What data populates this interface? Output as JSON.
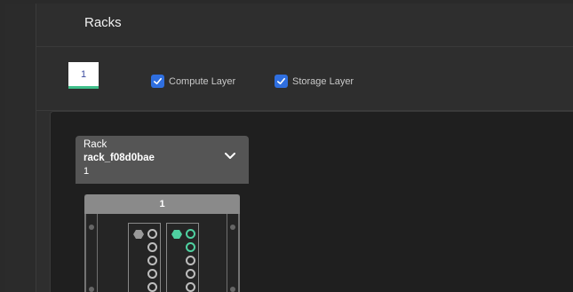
{
  "page": {
    "title": "Racks"
  },
  "controls": {
    "tab_label": "1",
    "compute_layer": {
      "label": "Compute Layer",
      "checked": true
    },
    "storage_layer": {
      "label": "Storage Layer",
      "checked": true
    }
  },
  "rack": {
    "type_label": "Rack",
    "name": "rack_f08d0bae",
    "number": "1",
    "header_label": "1"
  },
  "colors": {
    "accent_green": "#4fd1a1",
    "checkbox_blue": "#2f6fe0",
    "tab_underline": "#3fbf8a"
  },
  "icons": [
    "chevron-down-icon",
    "checkmark-icon",
    "hexagon-indicator-icon",
    "port-icon"
  ]
}
